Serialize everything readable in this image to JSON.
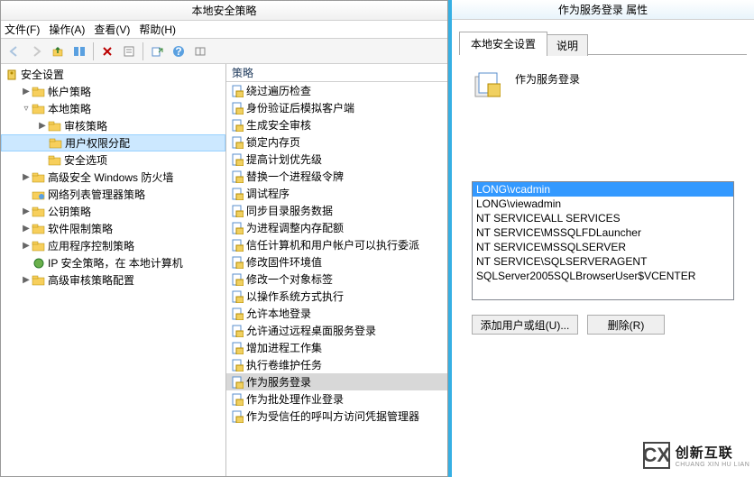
{
  "window": {
    "title": "本地安全策略",
    "menu": {
      "file": "文件(F)",
      "action": "操作(A)",
      "view": "查看(V)",
      "help": "帮助(H)"
    }
  },
  "toolbar": {
    "back": "back-icon",
    "forward": "forward-icon",
    "up": "up-icon",
    "props": "properties-icon",
    "delete": "delete-icon",
    "export": "export-icon",
    "refresh": "refresh-icon",
    "help": "help-icon",
    "list": "list-icon"
  },
  "tree": {
    "root": "安全设置",
    "items": [
      {
        "label": "帐户策略",
        "indent": 1,
        "exp": "▶",
        "icon": "folder"
      },
      {
        "label": "本地策略",
        "indent": 1,
        "exp": "▿",
        "icon": "folder"
      },
      {
        "label": "审核策略",
        "indent": 2,
        "exp": "▶",
        "icon": "folder"
      },
      {
        "label": "用户权限分配",
        "indent": 2,
        "exp": "",
        "icon": "folder",
        "selected": true
      },
      {
        "label": "安全选项",
        "indent": 2,
        "exp": "",
        "icon": "folder"
      },
      {
        "label": "高级安全 Windows 防火墙",
        "indent": 1,
        "exp": "▶",
        "icon": "folder"
      },
      {
        "label": "网络列表管理器策略",
        "indent": 1,
        "exp": "",
        "icon": "netfolder"
      },
      {
        "label": "公钥策略",
        "indent": 1,
        "exp": "▶",
        "icon": "folder"
      },
      {
        "label": "软件限制策略",
        "indent": 1,
        "exp": "▶",
        "icon": "folder"
      },
      {
        "label": "应用程序控制策略",
        "indent": 1,
        "exp": "▶",
        "icon": "folder"
      },
      {
        "label": "IP 安全策略，在 本地计算机",
        "indent": 1,
        "exp": "",
        "icon": "ip"
      },
      {
        "label": "高级审核策略配置",
        "indent": 1,
        "exp": "▶",
        "icon": "folder"
      }
    ]
  },
  "policy_list": {
    "header": "策略",
    "items": [
      "绕过遍历检查",
      "身份验证后模拟客户端",
      "生成安全审核",
      "锁定内存页",
      "提高计划优先级",
      "替换一个进程级令牌",
      "调试程序",
      "同步目录服务数据",
      "为进程调整内存配额",
      "信任计算机和用户帐户可以执行委派",
      "修改固件环境值",
      "修改一个对象标签",
      "以操作系统方式执行",
      "允许本地登录",
      "允许通过远程桌面服务登录",
      "增加进程工作集",
      "执行卷维护任务",
      "作为服务登录",
      "作为批处理作业登录",
      "作为受信任的呼叫方访问凭据管理器"
    ],
    "selected_index": 17
  },
  "properties": {
    "title": "作为服务登录 属性",
    "tabs": {
      "t1": "本地安全设置",
      "t2": "说明"
    },
    "policy_name": "作为服务登录",
    "users": [
      "LONG\\vcadmin",
      "LONG\\viewadmin",
      "NT SERVICE\\ALL SERVICES",
      "NT SERVICE\\MSSQLFDLauncher",
      "NT SERVICE\\MSSQLSERVER",
      "NT SERVICE\\SQLSERVERAGENT",
      "SQLServer2005SQLBrowserUser$VCENTER"
    ],
    "selected_user_index": 0,
    "buttons": {
      "add": "添加用户或组(U)...",
      "remove": "删除(R)"
    }
  },
  "watermark": {
    "logo": "CX",
    "cn": "创新互联",
    "en": "CHUANG XIN HU LIAN"
  }
}
